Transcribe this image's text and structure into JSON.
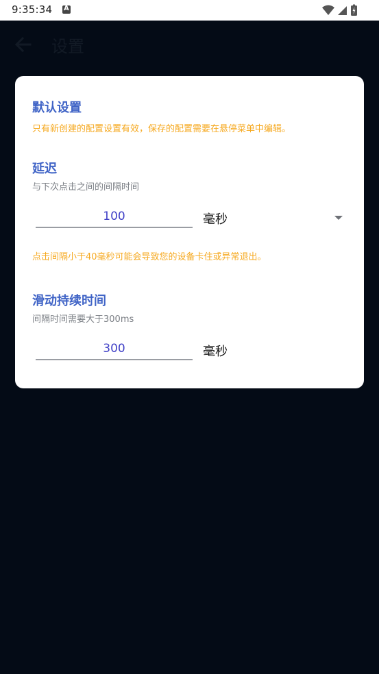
{
  "status_bar": {
    "time": "9:35:34"
  },
  "app_bar": {
    "title": "设置"
  },
  "dialog": {
    "default_section": {
      "title": "默认设置",
      "warning": "只有新创建的配置设置有效，保存的配置需要在悬停菜单中编辑。"
    },
    "delay_section": {
      "title": "延迟",
      "description": "与下次点击之间的间隔时间",
      "value": "100",
      "unit": "毫秒",
      "warning": "点击间隔小于40毫秒可能会导致您的设备卡住或异常退出。"
    },
    "swipe_section": {
      "title": "滑动持续时间",
      "description": "间隔时间需要大于300ms",
      "value": "300",
      "unit": "毫秒"
    }
  },
  "colors": {
    "accent": "#3f63c6",
    "warning": "#f6a920",
    "background": "#040b16"
  }
}
